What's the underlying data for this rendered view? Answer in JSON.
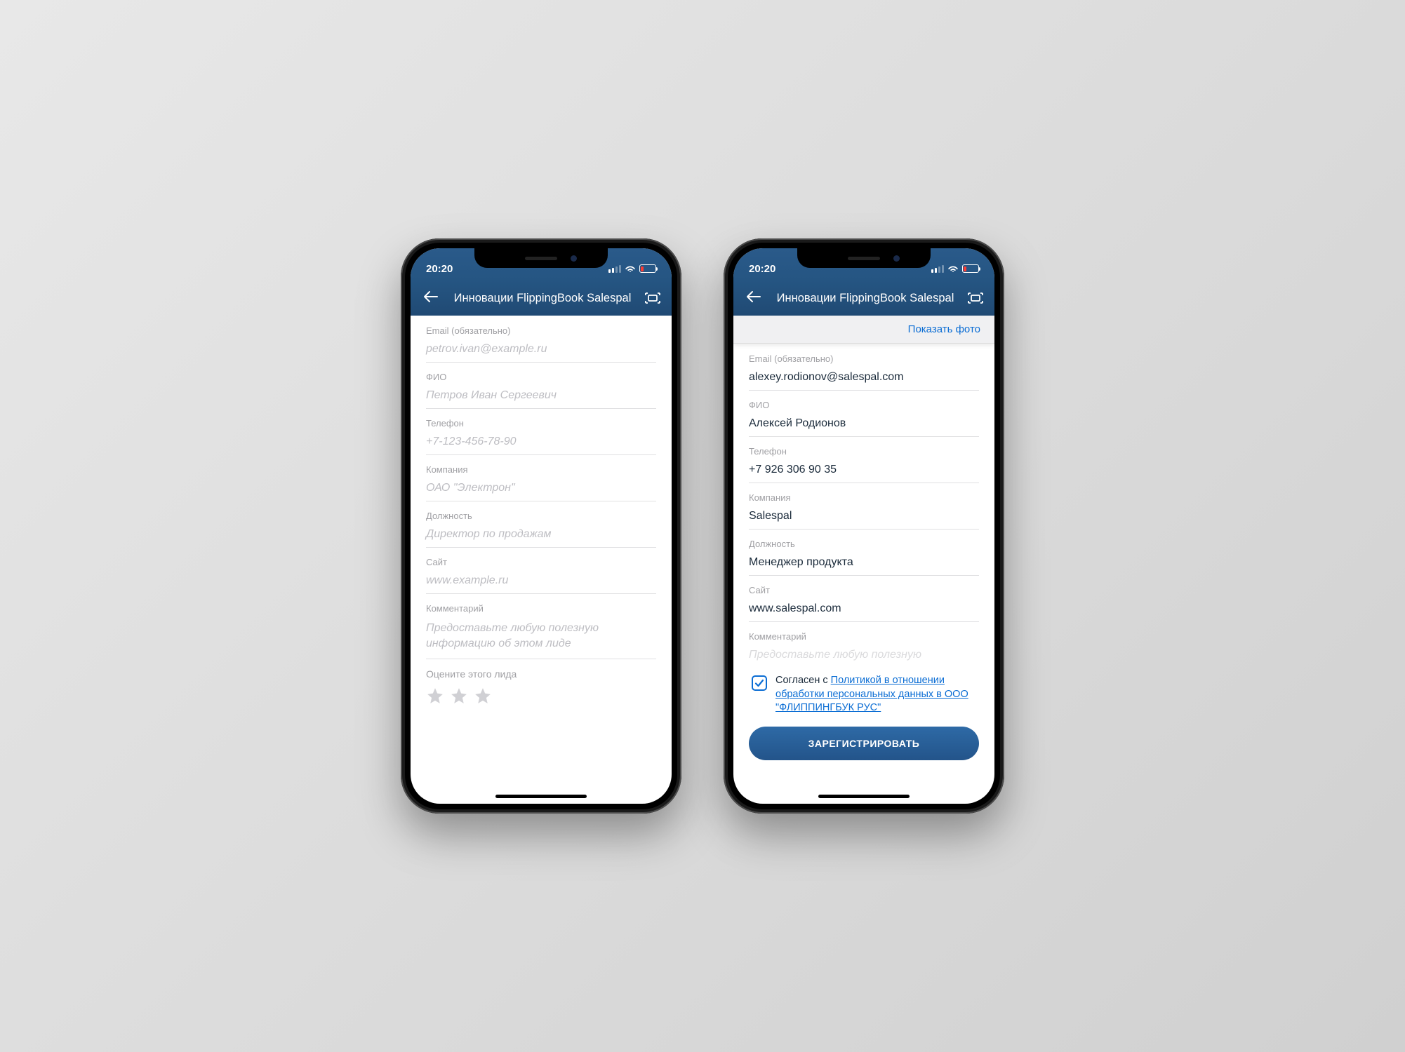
{
  "status": {
    "time": "20:20"
  },
  "navbar": {
    "title": "Инновации FlippingBook Salespal"
  },
  "topbar": {
    "show_photo": "Показать фото"
  },
  "labels": {
    "email": "Email (обязательно)",
    "fio": "ФИО",
    "phone": "Телефон",
    "company": "Компания",
    "role": "Должность",
    "site": "Сайт",
    "comment": "Комментарий",
    "rate": "Оцените этого лида"
  },
  "phone1": {
    "placeholders": {
      "email": "petrov.ivan@example.ru",
      "fio": "Петров Иван Сергеевич",
      "phone": "+7-123-456-78-90",
      "company": "ОАО \"Электрон\"",
      "role": "Директор по продажам",
      "site": "www.example.ru",
      "comment": "Предоставьте любую полезную информацию об этом лиде"
    }
  },
  "phone2": {
    "values": {
      "email": "alexey.rodionov@salespal.com",
      "fio": "Алексей Родионов",
      "phone": "+7 926 306 90 35",
      "company": "Salespal",
      "role": "Менеджер продукта",
      "site": "www.salespal.com"
    },
    "comment_hint": "Предоставьте любую полезную",
    "consent_prefix": "Согласен с ",
    "consent_link": "Политикой в отношении обработки персональных данных в ООО \"ФЛИППИНГБУК РУС\"",
    "register": "ЗАРЕГИСТРИРОВАТЬ"
  }
}
